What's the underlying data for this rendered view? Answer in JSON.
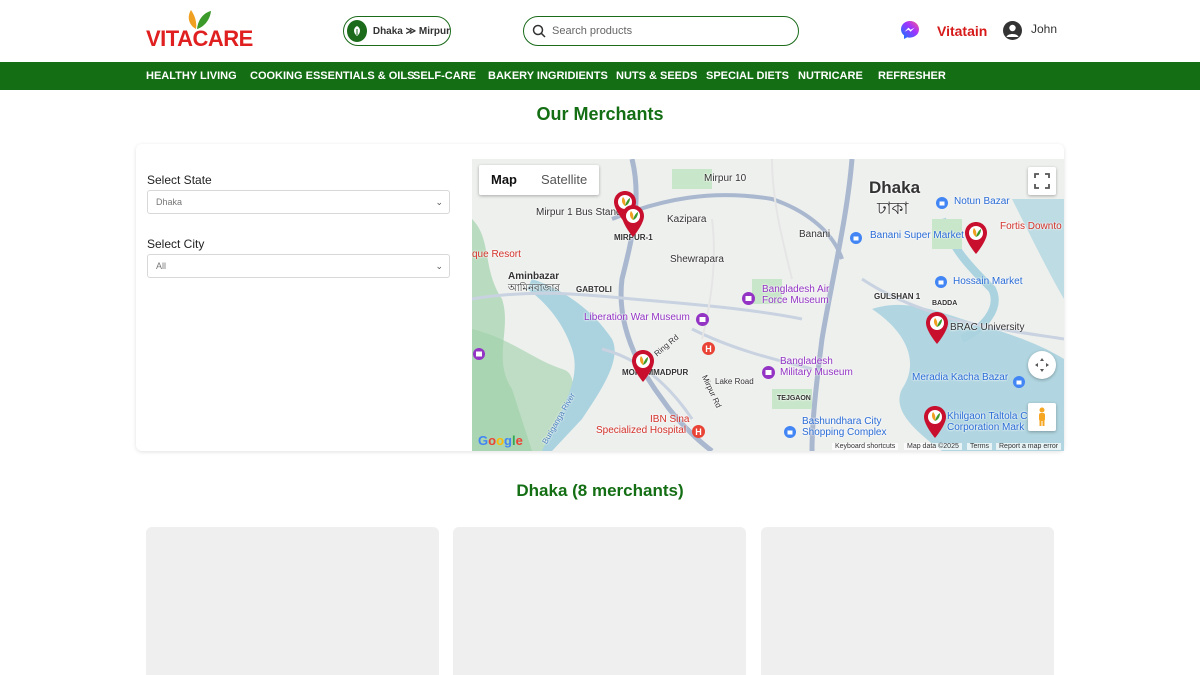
{
  "header": {
    "logo_text_a": "VITA",
    "logo_text_b": "CARE",
    "location": "Dhaka ≫ Mirpur",
    "search_placeholder": "Search products",
    "vitatain": "Vitatain",
    "user_name": "John"
  },
  "nav": {
    "items": [
      "HEALTHY LIVING",
      "COOKING ESSENTIALS & OILS",
      "SELF-CARE",
      "BAKERY INGRIDIENTS",
      "NUTS & SEEDS",
      "SPECIAL DIETS",
      "NUTRICARE",
      "REFRESHER"
    ]
  },
  "page": {
    "title": "Our Merchants",
    "state_label": "Select State",
    "state_value": "Dhaka",
    "city_label": "Select City",
    "city_value": "All",
    "merchants_heading": "Dhaka (8 merchants)"
  },
  "map": {
    "tab_map": "Map",
    "tab_satellite": "Satellite",
    "labels": {
      "dhaka_en": "Dhaka",
      "dhaka_bn": "ঢাকা",
      "mirpur10": "Mirpur 10",
      "mirpur1_bus": "Mirpur 1 Bus Stand",
      "mirpur1": "MIRPUR-1",
      "kazipara": "Kazipara",
      "shewrapara": "Shewrapara",
      "banani": "Banani",
      "banani_super": "Banani Super Market",
      "notun_bazar": "Notun Bazar",
      "fortis": "Fortis Downto",
      "aminbazar": "Aminbazar",
      "aminbazar_bn": "আমিনবাজার",
      "gabtoli": "GABTOLI",
      "resort": "que Resort",
      "baf_museum_1": "Bangladesh Air",
      "baf_museum_2": "Force Museum",
      "gulshan1": "GULSHAN 1",
      "hossain": "Hossain Market",
      "badda": "BADDA",
      "brac": "BRAC University",
      "liberation": "Liberation War Museum",
      "ring_rd": "Ring Rd",
      "mohammadpur": "MOHAMMADPUR",
      "mil_museum_1": "Bangladesh",
      "mil_museum_2": "Military Museum",
      "lake_road": "Lake Road",
      "mirpur_rd": "Mirpur Rd",
      "tejgaon": "TEJGAON",
      "meradia": "Meradia Kacha Bazar",
      "khilgaon_1": "Khilgaon Taltola C",
      "khilgaon_2": "Corporation Mark",
      "ibn_sina_1": "IBN Sina",
      "ibn_sina_2": "Specialized Hospital",
      "bashundhara_1": "Bashundhara City",
      "bashundhara_2": "Shopping Complex",
      "buriganga": "Buriganga River"
    },
    "google": "Google",
    "keyboard": "Keyboard shortcuts",
    "map_data": "Map data ©2025",
    "terms": "Terms",
    "report": "Report a map error"
  },
  "colors": {
    "brand_green": "#146e14",
    "brand_red": "#d61a1a",
    "marker_red": "#c8102e"
  }
}
